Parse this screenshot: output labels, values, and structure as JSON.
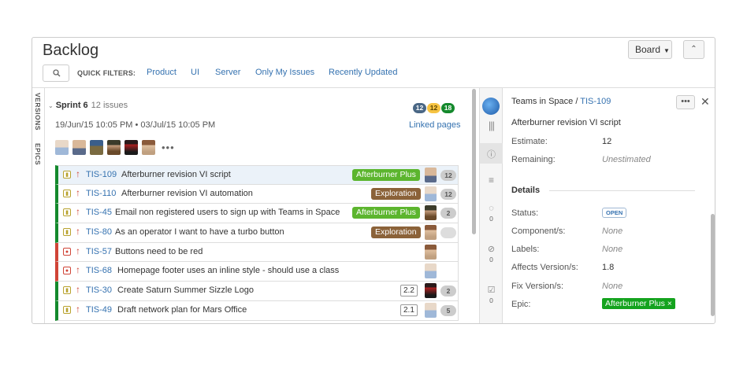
{
  "header": {
    "title": "Backlog",
    "board_label": "Board",
    "collapse_glyph": "⌃"
  },
  "quick_filters": {
    "label": "QUICK FILTERS:",
    "items": [
      "Product",
      "UI",
      "Server",
      "Only My Issues",
      "Recently Updated"
    ]
  },
  "side_tabs": [
    "VERSIONS",
    "EPICS"
  ],
  "sprint": {
    "name": "Sprint 6",
    "count": "12 issues",
    "badges": [
      {
        "value": "12",
        "color": "#4a6785"
      },
      {
        "value": "12",
        "color": "#f6c342"
      },
      {
        "value": "18",
        "color": "#14892c"
      }
    ],
    "dates": "19/Jun/15 10:05 PM • 03/Jul/15 10:05 PM",
    "linked_pages": "Linked pages",
    "more": "•••"
  },
  "issues": [
    {
      "key": "TIS-109",
      "summary": "Afterburner revision VI script",
      "type": "story",
      "epic": "Afterburner Plus",
      "epic_color": "#5cb52e",
      "estimate": "12",
      "selected": true
    },
    {
      "key": "TIS-110",
      "summary": "Afterburner revision VI automation",
      "type": "story",
      "epic": "Exploration",
      "epic_color": "#8b6239",
      "estimate": "12",
      "selected": false
    },
    {
      "key": "TIS-45",
      "summary": "Email non registered users to sign up with Teams in Space",
      "type": "story",
      "epic": "Afterburner Plus",
      "epic_color": "#5cb52e",
      "estimate": "2",
      "selected": false
    },
    {
      "key": "TIS-80",
      "summary": "As an operator I want to have a turbo button",
      "type": "story",
      "epic": "Exploration",
      "epic_color": "#8b6239",
      "estimate": "",
      "selected": false
    },
    {
      "key": "TIS-57",
      "summary": "Buttons need to be red",
      "type": "bug",
      "epic": "",
      "estimate": "",
      "selected": false
    },
    {
      "key": "TIS-68",
      "summary": "Homepage footer uses an inline style - should use a class",
      "type": "bug",
      "epic": "",
      "estimate": "",
      "selected": false
    },
    {
      "key": "TIS-30",
      "summary": "Create Saturn Summer Sizzle Logo",
      "type": "story",
      "version": "2.2",
      "estimate": "2",
      "selected": false
    },
    {
      "key": "TIS-49",
      "summary": "Draft network plan for Mars Office",
      "type": "story",
      "version": "2.1",
      "estimate": "5",
      "selected": false
    }
  ],
  "side_panel": {
    "comment_count": "0",
    "attachment_count": "0",
    "subtask_count": "0"
  },
  "detail": {
    "project": "Teams in Space",
    "separator": "/",
    "key": "TIS-109",
    "more_glyph": "•••",
    "close_glyph": "✕",
    "summary": "Afterburner revision VI script",
    "estimate_label": "Estimate:",
    "estimate_value": "12",
    "remaining_label": "Remaining:",
    "remaining_value": "Unestimated",
    "section": "Details",
    "status_label": "Status:",
    "status_value": "OPEN",
    "component_label": "Component/s:",
    "component_value": "None",
    "labels_label": "Labels:",
    "labels_value": "None",
    "affects_label": "Affects Version/s:",
    "affects_value": "1.8",
    "fix_label": "Fix Version/s:",
    "fix_value": "None",
    "epic_label": "Epic:",
    "epic_value": "Afterburner Plus ×"
  }
}
